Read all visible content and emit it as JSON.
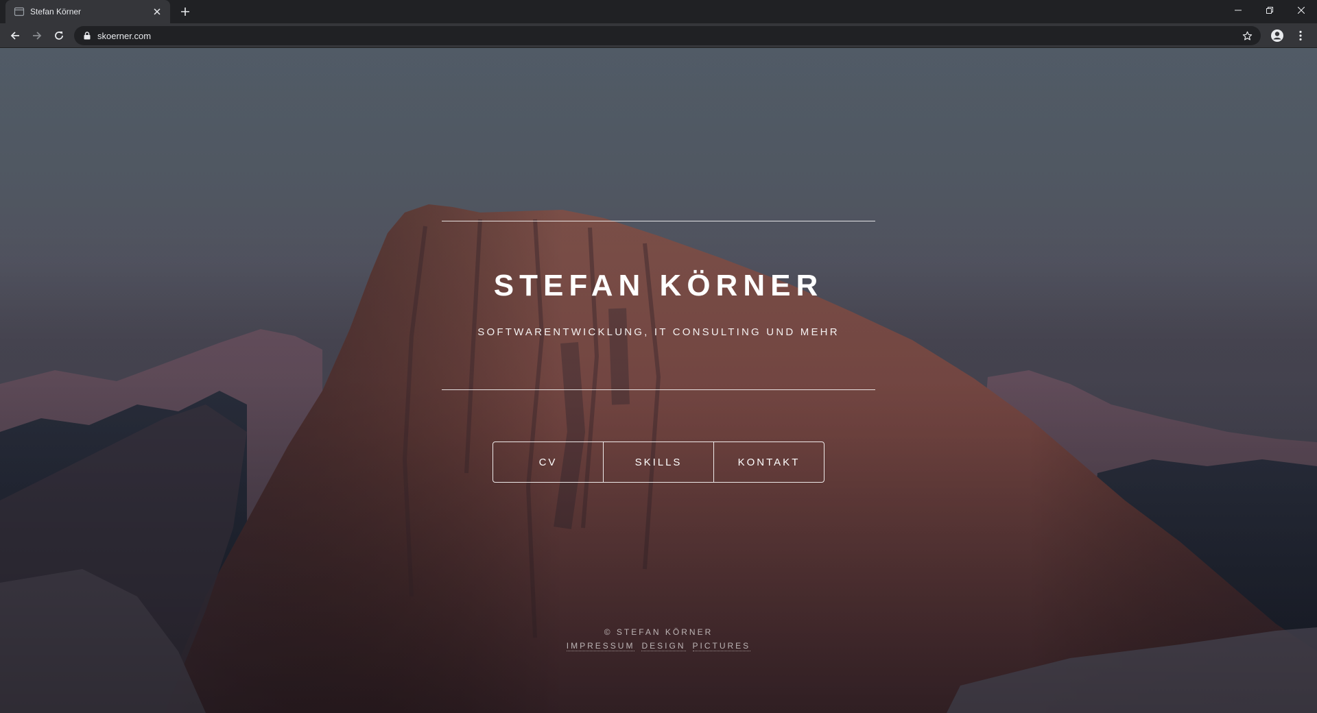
{
  "browser": {
    "tab_title": "Stefan Körner",
    "url": "skoerner.com"
  },
  "page": {
    "title": "STEFAN KÖRNER",
    "subtitle": "SOFTWARENTWICKLUNG, IT CONSULTING UND MEHR",
    "nav": [
      {
        "label": "CV"
      },
      {
        "label": "SKILLS"
      },
      {
        "label": "KONTAKT"
      }
    ],
    "footer": {
      "copyright": "© STEFAN KÖRNER",
      "links": [
        {
          "label": "IMPRESSUM"
        },
        {
          "label": "DESIGN"
        },
        {
          "label": "PICTURES"
        }
      ]
    }
  },
  "colors": {
    "chrome_dark": "#202124",
    "chrome_tab": "#35363a",
    "text_light": "#e8eaed",
    "rock": "#7a4a44",
    "sky": "#5f6b78"
  },
  "icons": {
    "back": "arrow-left",
    "forward": "arrow-right",
    "reload": "reload",
    "lock": "lock",
    "bookmark": "star",
    "profile": "account-circle",
    "menu": "vertical-dots"
  }
}
